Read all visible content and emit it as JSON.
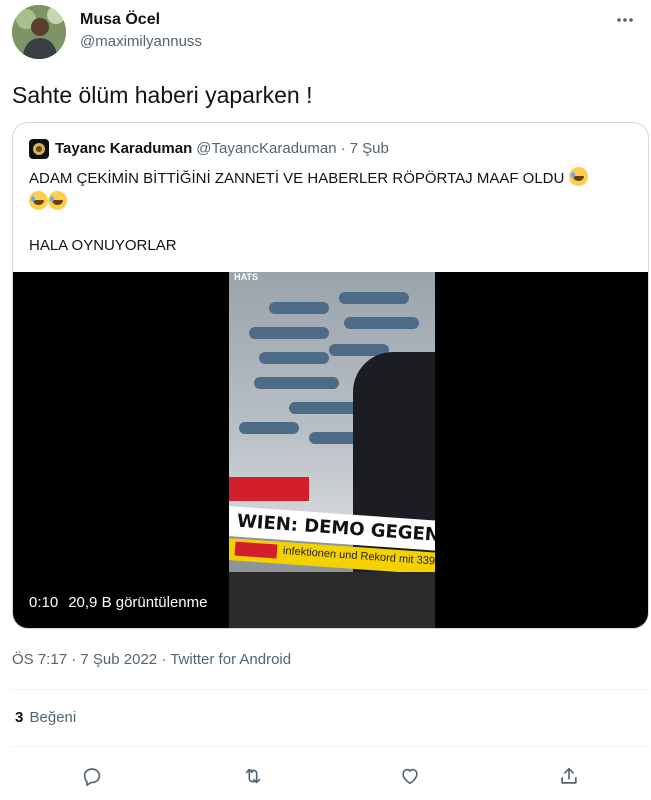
{
  "author": {
    "name": "Musa Öcel",
    "handle": "@maximilyannuss"
  },
  "tweet": {
    "text": "Sahte ölüm haberi yaparken !"
  },
  "quoted_tweet": {
    "name": "Tayanc Karaduman",
    "handle": "@TayancKaraduman",
    "separator": "·",
    "date": "7 Şub",
    "line1": "ADAM ÇEKİMİN BİTTİĞİNİ ZANNETİ VE HABERLER RÖPÖRTAJ MAAF OLDU",
    "line3": "HALA OYNUYORLAR",
    "video": {
      "duration": "0:10",
      "views": "20,9 B görüntülenme",
      "overlay_logo": "HATS",
      "overlay_headline": "WIEN: DEMO GEGEN KLIMA",
      "overlay_ticker": "infektionen und Rekord mit 339."
    }
  },
  "meta": {
    "time": "ÖS 7:17",
    "separator": "·",
    "date": "7 Şub 2022",
    "source": "Twitter for Android"
  },
  "engagement": {
    "likes_count": "3",
    "likes_label": "Beğeni"
  },
  "icons": {
    "more": "more-icon",
    "reply": "reply-icon",
    "retweet": "retweet-icon",
    "like": "like-icon",
    "share": "share-icon"
  },
  "colors": {
    "text_primary": "#0f1419",
    "text_secondary": "#536471",
    "border": "#cfd9de"
  }
}
